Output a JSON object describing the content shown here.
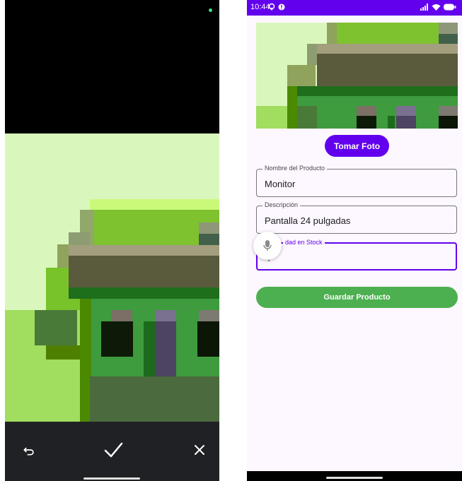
{
  "camera": {
    "retake_icon": "undo-icon",
    "confirm_icon": "check-icon",
    "cancel_icon": "close-icon"
  },
  "status_bar": {
    "time": "10:44",
    "icons_left": [
      "location-icon",
      "alert-icon"
    ],
    "icons_right": [
      "signal-icon",
      "wifi-icon",
      "battery-icon"
    ]
  },
  "form": {
    "take_photo_label": "Tomar Foto",
    "product_name": {
      "label": "Nombre del Producto",
      "value": "Monitor"
    },
    "description": {
      "label": "Descripción",
      "value": "Pantalla 24 pulgadas"
    },
    "stock": {
      "label": "Cantidad en Stock",
      "visible_label": "dad en Stock",
      "value": "4"
    },
    "save_label": "Guardar Producto"
  },
  "colors": {
    "primary": "#6200ee",
    "save_button": "#4caf50",
    "camera_controls": "#202124"
  }
}
